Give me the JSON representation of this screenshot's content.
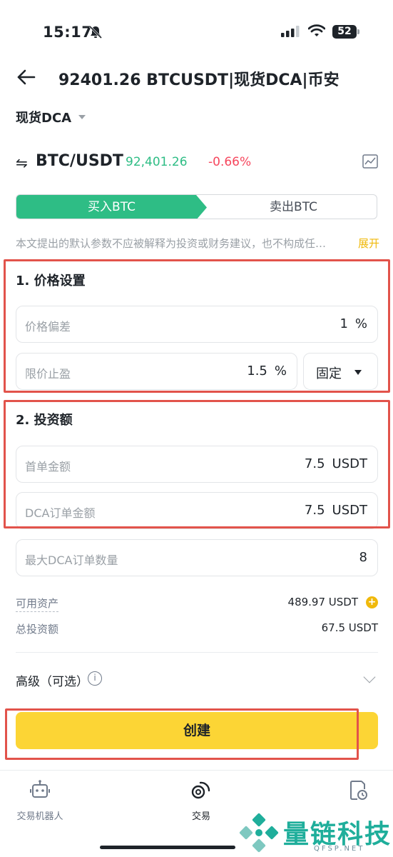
{
  "status_bar": {
    "time": "15:17",
    "battery": "52"
  },
  "header": {
    "title": "92401.26 BTCUSDT|现货DCA|币安"
  },
  "strategy": {
    "label": "现货DCA"
  },
  "pair": {
    "name": "BTC/USDT",
    "price": "92,401.26",
    "change": "-0.66%"
  },
  "side_tabs": {
    "buy": "买入BTC",
    "sell": "卖出BTC"
  },
  "disclaimer": {
    "text": "本文提出的默认参数不应被解释为投资或财务建议，也不构成任…",
    "expand": "展开"
  },
  "price_settings": {
    "title": "1. 价格设置",
    "deviation": {
      "label": "价格偏差",
      "value": "1",
      "unit": "%"
    },
    "take_profit": {
      "label": "限价止盈",
      "value": "1.5",
      "unit": "%"
    },
    "mode": "固定"
  },
  "investment": {
    "title": "2. 投资额",
    "first_order": {
      "label": "首单金额",
      "value": "7.5",
      "unit": "USDT"
    },
    "dca_order": {
      "label": "DCA订单金额",
      "value": "7.5",
      "unit": "USDT"
    },
    "max_orders": {
      "label": "最大DCA订单数量",
      "value": "8"
    }
  },
  "balances": {
    "available": {
      "label": "可用资产",
      "value": "489.97 USDT"
    },
    "total": {
      "label": "总投资额",
      "value": "67.5 USDT"
    }
  },
  "advanced": {
    "label": "高级（可选）"
  },
  "create_button": "创建",
  "bottom_nav": [
    {
      "label": "交易机器人"
    },
    {
      "label": "交易"
    }
  ],
  "watermark": {
    "text": "量链科技",
    "sub": "QFSP.NET"
  },
  "colors": {
    "buy_green": "#2ebd85",
    "sell_red": "#f6465d",
    "brand_yellow": "#fcd535",
    "annotation_red": "#e2534b"
  }
}
